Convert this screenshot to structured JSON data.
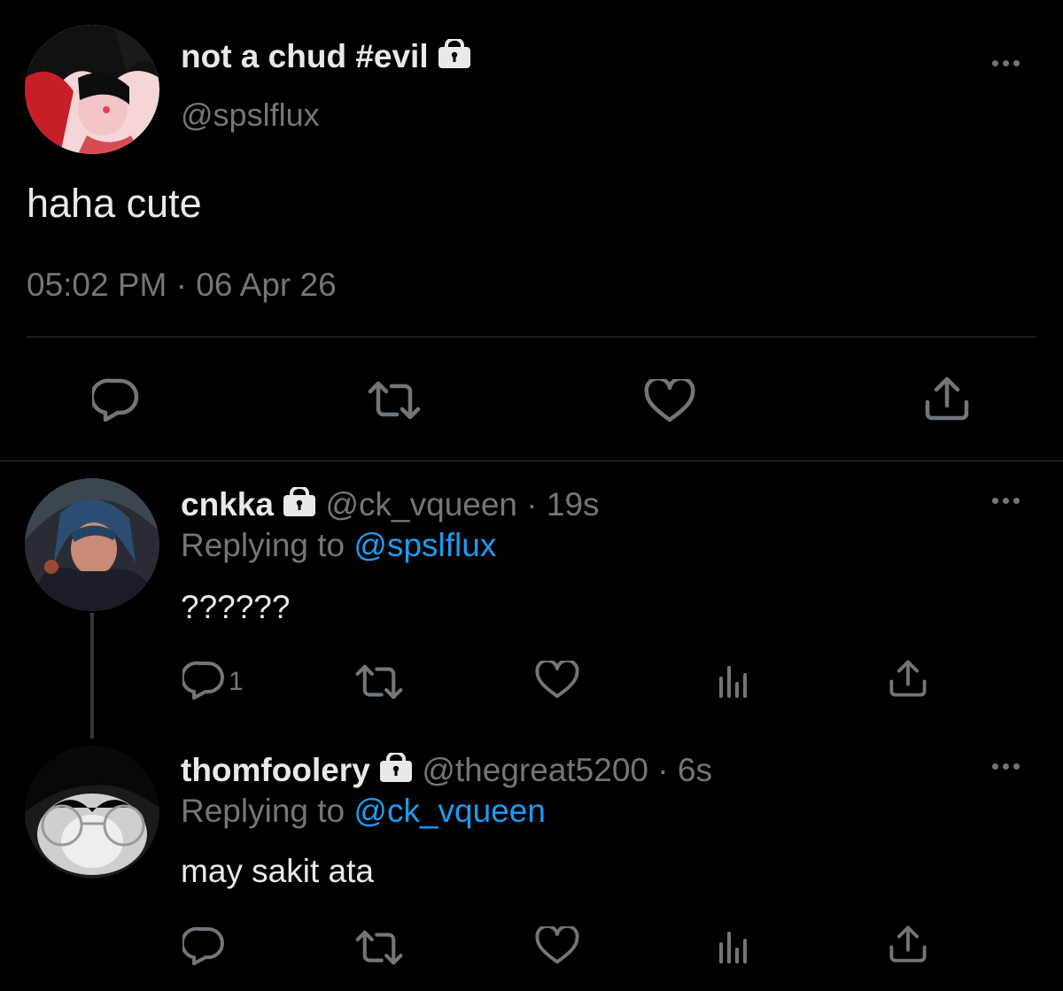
{
  "main_tweet": {
    "display_name": "not a chud #evil",
    "handle": "@spslflux",
    "text": "haha cute",
    "timestamp": "05:02 PM · 06 Apr 26"
  },
  "replies": [
    {
      "display_name": "cnkka",
      "handle": "@ck_vqueen",
      "time": "· 19s",
      "replying_prefix": "Replying to",
      "replying_to": "@spslflux",
      "text": "??????",
      "reply_count": "1"
    },
    {
      "display_name": "thomfoolery",
      "handle": "@thegreat5200",
      "time": "· 6s",
      "replying_prefix": "Replying to",
      "replying_to": "@ck_vqueen",
      "text": "may sakit ata",
      "reply_count": ""
    }
  ],
  "icons": {
    "lock": "lock-icon",
    "more": "more-icon",
    "reply": "reply-icon",
    "retweet": "retweet-icon",
    "like": "heart-icon",
    "views": "views-icon",
    "share": "share-icon"
  },
  "colors": {
    "background": "#000000",
    "text": "#e7e9ea",
    "muted": "#71767b",
    "link": "#1d9bf0"
  }
}
